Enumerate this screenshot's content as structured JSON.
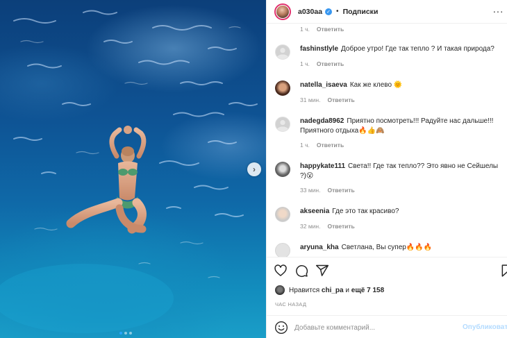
{
  "post": {
    "username": "a030aa",
    "separator": "•",
    "follow_label": "Подписки",
    "more_label": "···",
    "next_label": "›"
  },
  "partial_comment": {
    "time": "1 ч.",
    "reply": "Ответить"
  },
  "comments": [
    {
      "user": "fashinstlyle",
      "text": "Доброе утро! Где так тепло ? И такая природа?",
      "time": "1 ч.",
      "reply": "Ответить"
    },
    {
      "user": "natella_isaeva",
      "text": "Как же клево 🌞",
      "time": "31 мин.",
      "reply": "Ответить"
    },
    {
      "user": "nadegda8962",
      "text": "Приятно посмотреть!!! Радуйте нас дальше!!! Приятного отдыха🔥👍🙈",
      "time": "1 ч.",
      "reply": "Ответить"
    },
    {
      "user": "happykate111",
      "text": "Света!! Где так тепло?? Это явно не Сейшелы ?)😮",
      "time": "33 мин.",
      "reply": "Ответить"
    },
    {
      "user": "akseenia",
      "text": "Где это так красиво?",
      "time": "32 мин.",
      "reply": "Ответить"
    },
    {
      "user": "aryuna_kha",
      "text": "Светлана, Вы супер🔥🔥🔥"
    }
  ],
  "likes": {
    "prefix": "Нравится",
    "user": "chi_pa",
    "middle": "и",
    "rest": "ещё 7 158"
  },
  "posted": "ЧАС НАЗАД",
  "add_comment": {
    "placeholder": "Добавьте комментарий...",
    "publish": "Опубликовать"
  },
  "colors": {
    "accent": "#3897f0",
    "publish_disabled": "#b3dbff",
    "water_deep": "#0c3f7a",
    "water_shallow": "#1a9ec8"
  },
  "icons": [
    "verified-icon",
    "more-icon",
    "heart-icon",
    "comment-icon",
    "share-icon",
    "bookmark-icon",
    "smile-icon",
    "chevron-right-icon"
  ]
}
